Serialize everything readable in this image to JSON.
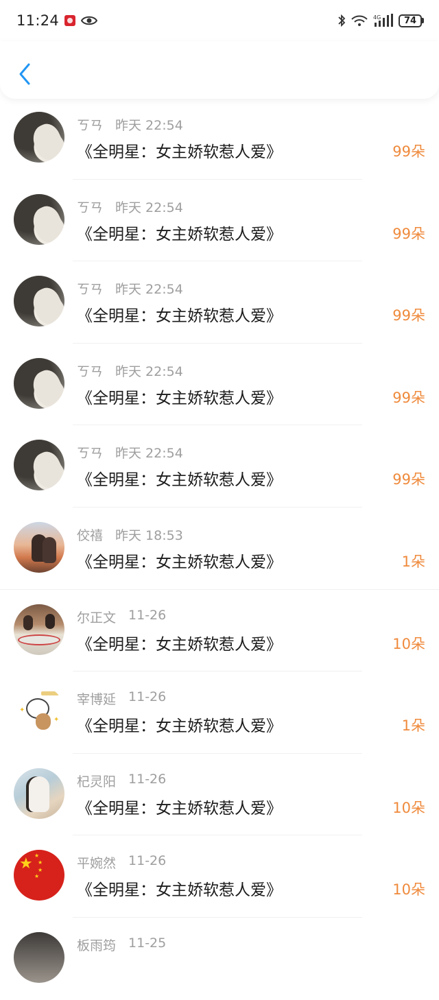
{
  "status_bar": {
    "time": "11:24",
    "network": "4G",
    "battery": "74"
  },
  "nav": {
    "back_icon": "chevron-left-icon",
    "accent_color": "#2196F3"
  },
  "colors": {
    "count": "#ef8a3c",
    "meta": "#9e9e9e",
    "title": "#1c1c1c"
  },
  "gifts": [
    {
      "name": "ㄎㄢ",
      "time": "昨天 22:54",
      "book": "《全明星：女主娇软惹人爱》",
      "count": "99朵",
      "avatar": "bw-photo"
    },
    {
      "name": "ㄎㄢ",
      "time": "昨天 22:54",
      "book": "《全明星：女主娇软惹人爱》",
      "count": "99朵",
      "avatar": "bw-photo"
    },
    {
      "name": "ㄎㄢ",
      "time": "昨天 22:54",
      "book": "《全明星：女主娇软惹人爱》",
      "count": "99朵",
      "avatar": "bw-photo"
    },
    {
      "name": "ㄎㄢ",
      "time": "昨天 22:54",
      "book": "《全明星：女主娇软惹人爱》",
      "count": "99朵",
      "avatar": "bw-photo"
    },
    {
      "name": "ㄎㄢ",
      "time": "昨天 22:54",
      "book": "《全明星：女主娇软惹人爱》",
      "count": "99朵",
      "avatar": "bw-photo"
    },
    {
      "name": "佼禧",
      "time": "昨天 18:53",
      "book": "《全明星：女主娇软惹人爱》",
      "count": "1朵",
      "avatar": "sunset-couple"
    },
    {
      "name": "尔正文",
      "time": "11-26",
      "book": "《全明星：女主娇软惹人爱》",
      "count": "10朵",
      "avatar": "dinner-photo"
    },
    {
      "name": "宰博延",
      "time": "11-26",
      "book": "《全明星：女主娇软惹人爱》",
      "count": "1朵",
      "avatar": "cartoon-bear"
    },
    {
      "name": "杞灵阳",
      "time": "11-26",
      "book": "《全明星：女主娇软惹人爱》",
      "count": "10朵",
      "avatar": "girl-photo"
    },
    {
      "name": "平婉然",
      "time": "11-26",
      "book": "《全明星：女主娇软惹人爱》",
      "count": "10朵",
      "avatar": "china-flag"
    },
    {
      "name": "板雨筠",
      "time": "11-25",
      "book": "",
      "count": "",
      "avatar": "partial-photo"
    }
  ]
}
